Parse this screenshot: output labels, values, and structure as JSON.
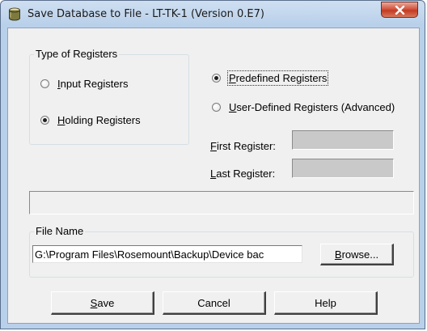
{
  "window": {
    "title": "Save Database to File - LT-TK-1 (Version 0.E7)"
  },
  "register_type": {
    "legend": "Type of Registers",
    "options": [
      {
        "accel": "I",
        "rest": "nput Registers",
        "selected": false
      },
      {
        "accel": "H",
        "rest": "olding Registers",
        "selected": true
      }
    ]
  },
  "register_range": {
    "options": [
      {
        "accel": "P",
        "rest": "redefined Registers",
        "selected": true
      },
      {
        "accel": "U",
        "rest": "ser-Defined Registers  (Advanced)",
        "selected": false
      }
    ],
    "first_accel": "F",
    "first_rest": "irst Register:",
    "last_accel": "L",
    "last_rest": "ast Register:",
    "first_value": "",
    "last_value": ""
  },
  "status_text": "",
  "file_name": {
    "legend": "File Name",
    "path": "G:\\Program Files\\Rosemount\\Backup\\Device bac",
    "browse_accel": "B",
    "browse_rest": "rowse..."
  },
  "buttons": {
    "save_accel": "S",
    "save_rest": "ave",
    "cancel": "Cancel",
    "help": "Help"
  },
  "colors": {
    "title_bar": "#b9d0ea",
    "client": "#f0f0f0",
    "close_button": "#c23a22",
    "disabled_field": "#c9c9c9"
  }
}
